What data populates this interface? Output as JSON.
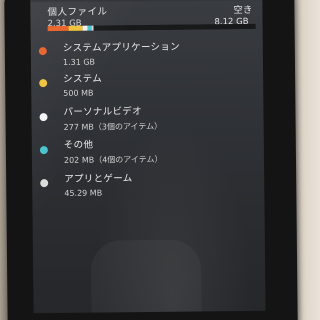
{
  "header": {
    "title": "個人ファイル",
    "used": "2.31 GB",
    "free_label": "空き",
    "free_value": "8.12 GB"
  },
  "storage_bar": {
    "colors": {
      "apps": "#e8622a",
      "system": "#f0c33a",
      "personal_video": "#f2f2f2",
      "other": "#4bc4d0",
      "apps_and_games": "#d7d7d7"
    }
  },
  "items": [
    {
      "name": "システムアプリケーション",
      "size": "1.31 GB",
      "color": "#e8622a"
    },
    {
      "name": "システム",
      "size": "500 MB",
      "color": "#f0c33a"
    },
    {
      "name": "パーソナルビデオ",
      "size": "277 MB（3個のアイテム）",
      "color": "#f4f4f4"
    },
    {
      "name": "その他",
      "size": "202 MB（4個のアイテム）",
      "color": "#4bc4d0"
    },
    {
      "name": "アプリとゲーム",
      "size": "45.29 MB",
      "color": "#dcdcdc"
    }
  ]
}
